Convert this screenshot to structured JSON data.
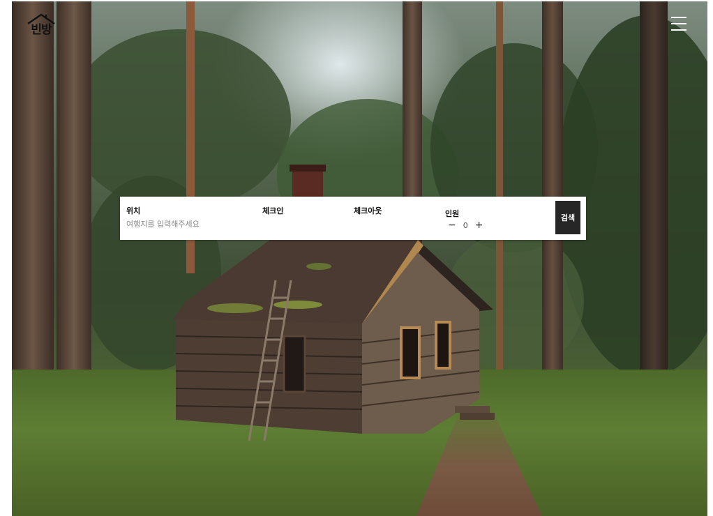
{
  "header": {
    "logo_text": "빈방",
    "menu_icon": "hamburger-menu-icon"
  },
  "search": {
    "location": {
      "label": "위치",
      "placeholder": "여행지를 입력해주세요",
      "value": ""
    },
    "checkin": {
      "label": "체크인",
      "value": ""
    },
    "checkout": {
      "label": "체크아웃",
      "value": ""
    },
    "guests": {
      "label": "인원",
      "minus": "−",
      "count": "0",
      "plus": "+"
    },
    "submit_label": "검색"
  },
  "colors": {
    "search_button": "#262626",
    "searchbar_bg": "#ffffff",
    "menu_icon": "#ffffff"
  }
}
